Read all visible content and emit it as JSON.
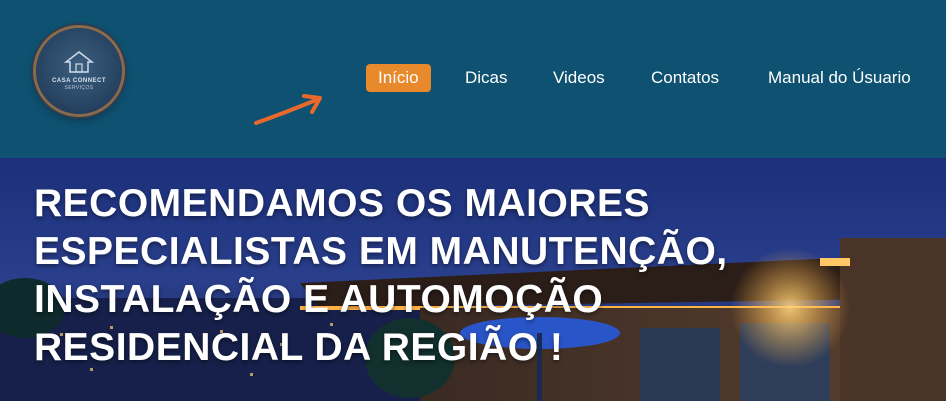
{
  "logo": {
    "line1": "CASA CONNECT",
    "line2": "SERVIÇOS"
  },
  "nav": {
    "items": [
      {
        "label": "Início",
        "active": true
      },
      {
        "label": "Dicas",
        "active": false
      },
      {
        "label": "Videos",
        "active": false
      },
      {
        "label": "Contatos",
        "active": false
      },
      {
        "label": "Manual do Úsuario",
        "active": false
      }
    ]
  },
  "hero": {
    "title": "RECOMENDAMOS OS MAIORES ESPECIALISTAS EM MANUTENÇÃO, INSTALAÇÃO E AUTOMOÇÃO RESIDENCIAL DA REGIÃO !"
  },
  "colors": {
    "header_bg": "#0e5170",
    "accent": "#e8892b",
    "nav_text": "#ffffff"
  },
  "icons": {
    "logo": "house-logo-icon",
    "pointer": "arrow-pointer-icon"
  }
}
